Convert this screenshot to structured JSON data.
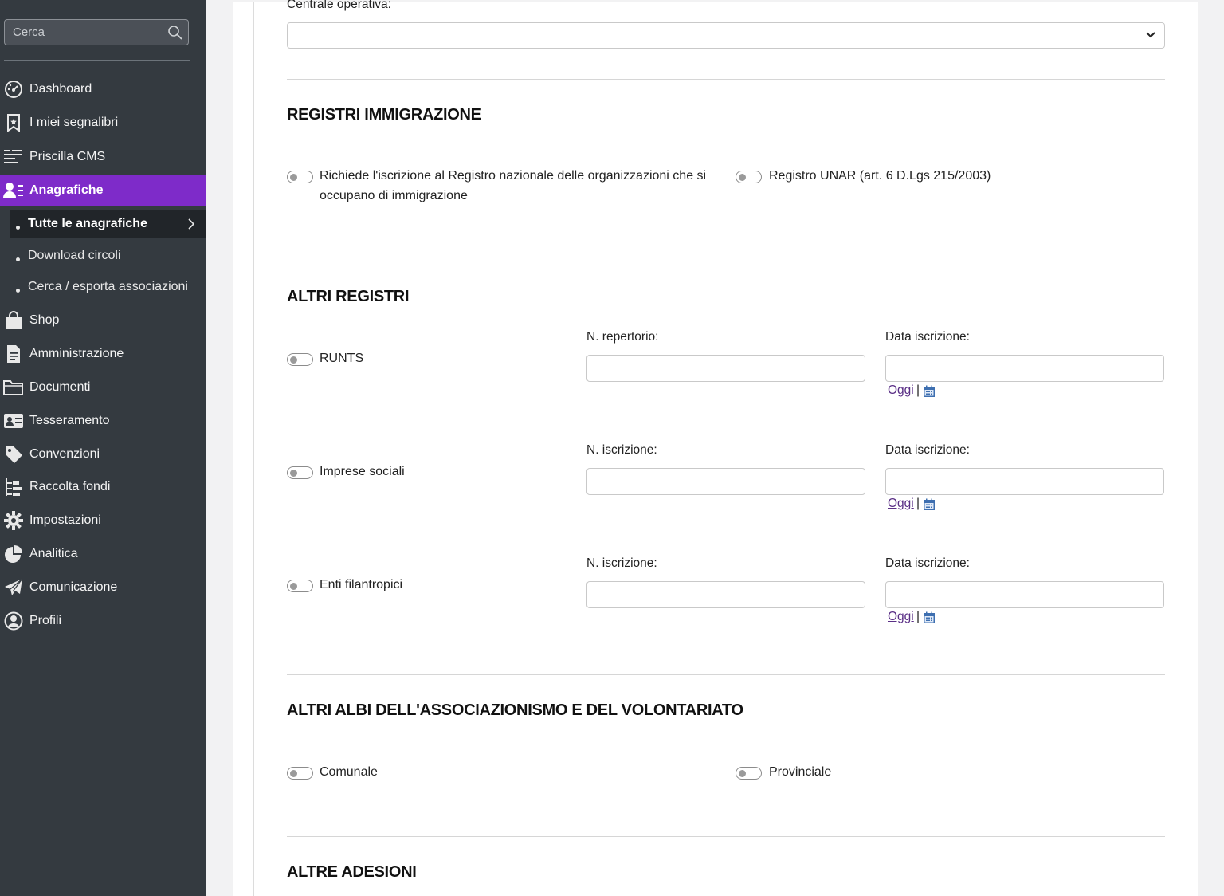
{
  "sidebar": {
    "search_placeholder": "Cerca",
    "items": [
      {
        "label": "Dashboard",
        "icon": "dashboard-icon"
      },
      {
        "label": "I miei segnalibri",
        "icon": "bookmark-icon"
      },
      {
        "label": "Priscilla CMS",
        "icon": "cms-icon"
      },
      {
        "label": "Anagrafiche",
        "icon": "user-list-icon",
        "active": true
      },
      {
        "label": "Shop",
        "icon": "shopping-bag-icon"
      },
      {
        "label": "Amministrazione",
        "icon": "document-icon"
      },
      {
        "label": "Documenti",
        "icon": "folder-icon"
      },
      {
        "label": "Tesseramento",
        "icon": "id-card-icon"
      },
      {
        "label": "Convenzioni",
        "icon": "tag-icon"
      },
      {
        "label": "Raccolta fondi",
        "icon": "tree-list-icon"
      },
      {
        "label": "Impostazioni",
        "icon": "gear-icon"
      },
      {
        "label": "Analitica",
        "icon": "pie-chart-icon"
      },
      {
        "label": "Comunicazione",
        "icon": "paper-plane-icon"
      },
      {
        "label": "Profili",
        "icon": "user-circle-icon"
      }
    ],
    "subitems": [
      {
        "label": "Tutte le anagrafiche",
        "current": true
      },
      {
        "label": "Download circoli"
      },
      {
        "label": "Cerca / esporta associazioni"
      }
    ]
  },
  "form": {
    "centrale_label": "Centrale operativa:",
    "centrale_value": "",
    "sections": {
      "immigrazione_title": "REGISTRI IMMIGRAZIONE",
      "altri_registri_title": "ALTRI REGISTRI",
      "albi_title": "ALTRI ALBI DELL'ASSOCIAZIONISMO E DEL VOLONTARIATO",
      "adesioni_title": "ALTRE ADESIONI"
    },
    "immigrazione": {
      "toggle1_label": "Richiede l'iscrizione al Registro nazionale delle organizzazioni che si occupano di immigrazione",
      "toggle2_label": "Registro UNAR (art. 6 D.Lgs 215/2003)"
    },
    "registri": [
      {
        "toggle_label": "RUNTS",
        "number_label": "N. repertorio:",
        "date_label": "Data iscrizione:",
        "today_link": "Oggi",
        "separator": "|"
      },
      {
        "toggle_label": "Imprese sociali",
        "number_label": "N. iscrizione:",
        "date_label": "Data iscrizione:",
        "today_link": "Oggi",
        "separator": "|"
      },
      {
        "toggle_label": "Enti filantropici",
        "number_label": "N. iscrizione:",
        "date_label": "Data iscrizione:",
        "today_link": "Oggi",
        "separator": "|"
      }
    ],
    "albi": {
      "comunale_label": "Comunale",
      "provinciale_label": "Provinciale"
    }
  },
  "colors": {
    "sidebar_bg": "#343a40",
    "active_bg": "#7e2bc9",
    "link": "#5a2f86"
  }
}
